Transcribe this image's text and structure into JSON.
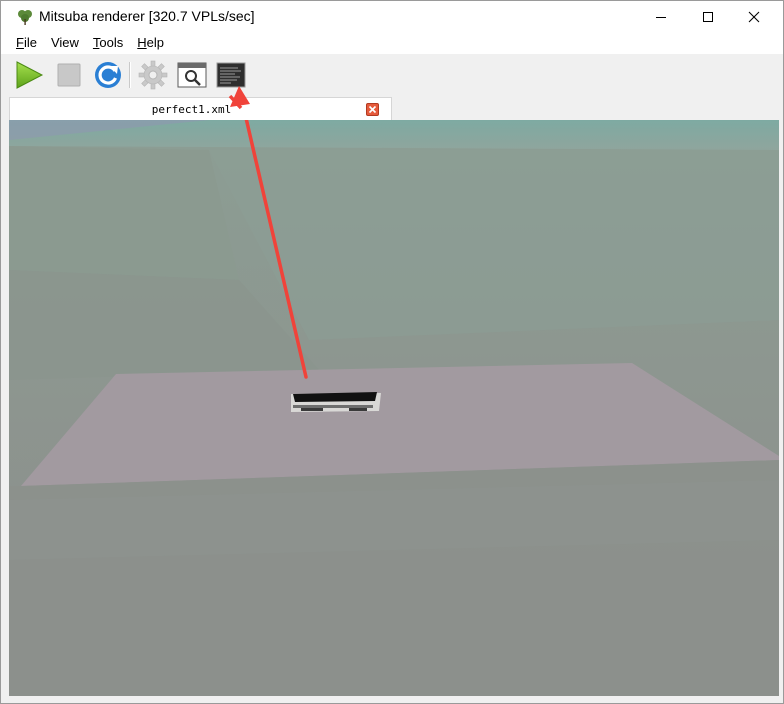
{
  "window": {
    "title": "Mitsuba renderer [320.7 VPLs/sec]",
    "app_icon": "clover-icon"
  },
  "menu": {
    "items": [
      {
        "label_prefix": "",
        "label_underlined": "F",
        "label_rest": "ile"
      },
      {
        "label_prefix": "",
        "label_underlined": "V",
        "label_rest": "iew"
      },
      {
        "label_prefix": "",
        "label_underlined": "T",
        "label_rest": "ools"
      },
      {
        "label_prefix": "",
        "label_underlined": "H",
        "label_rest": "elp"
      }
    ]
  },
  "toolbar": {
    "buttons": [
      {
        "name": "render-button",
        "icon": "play-icon",
        "enabled": true
      },
      {
        "name": "stop-button",
        "icon": "stop-icon",
        "enabled": false
      },
      {
        "name": "refresh-button",
        "icon": "refresh-icon",
        "enabled": true
      },
      {
        "name": "settings-button",
        "icon": "gear-icon",
        "enabled": false
      },
      {
        "name": "preview-button",
        "icon": "magnifier-window-icon",
        "enabled": true
      },
      {
        "name": "log-button",
        "icon": "terminal-icon",
        "enabled": true
      }
    ]
  },
  "tabs": [
    {
      "label": "perfect1.xml",
      "active": true
    }
  ],
  "colors": {
    "play_green": "#7cbd2b",
    "refresh_blue": "#2a7fd4",
    "tab_close": "#e55a3b",
    "floor_plane": "#a29aa0",
    "sky": "#7fa9a2",
    "annotation_arrow": "#f0433a"
  }
}
